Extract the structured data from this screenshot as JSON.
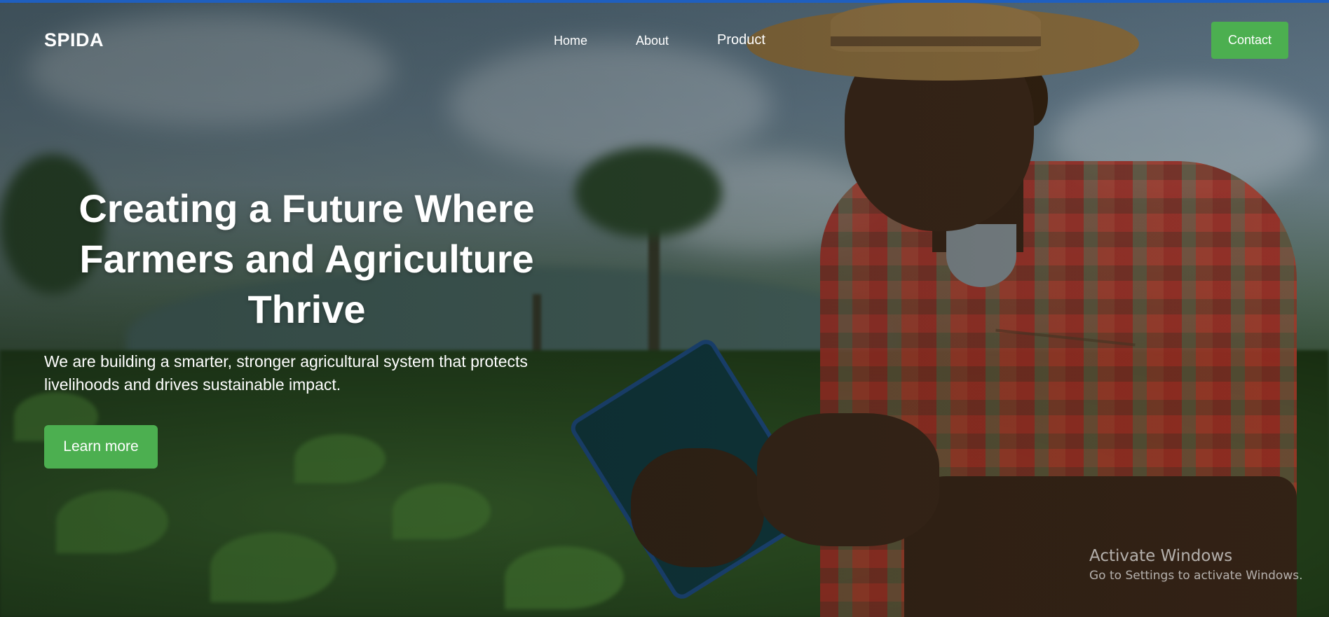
{
  "nav": {
    "logo": "SPIDA",
    "links": [
      {
        "label": "Home"
      },
      {
        "label": "About"
      },
      {
        "label": "Product"
      }
    ],
    "contact_label": "Contact"
  },
  "hero": {
    "headline": "Creating a Future Where Farmers and Agriculture Thrive",
    "subtext": "We are building a smarter, stronger agricultural system that protects livelihoods and drives sustainable impact.",
    "cta_label": "Learn more",
    "background_image": "farmer-with-tablet-in-crop-field"
  },
  "watermark": {
    "title": "Activate Windows",
    "subtitle": "Go to Settings to activate Windows."
  },
  "colors": {
    "accent": "#4caf50",
    "text": "#ffffff",
    "top_border": "#1f5fbf"
  }
}
